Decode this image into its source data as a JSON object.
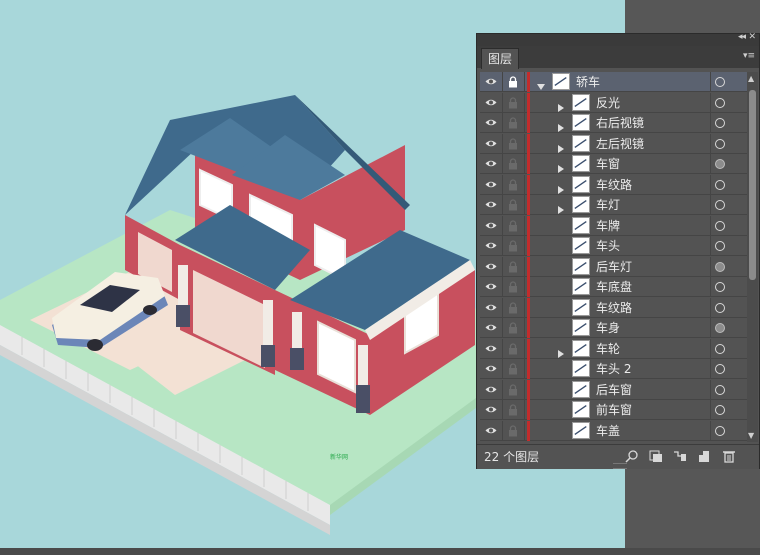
{
  "panel": {
    "tab_label": "图层",
    "collapse_glyph": "◂◂",
    "close_glyph": "✕",
    "menu_glyph": "▾≡",
    "footer_count": "22 个图层",
    "colors": {
      "panel_bg": "#535353",
      "layer_color": "#c22c2c",
      "top_row_bg": "#5b6270"
    }
  },
  "layers": [
    {
      "name": "轿车",
      "level": 0,
      "expanded": true,
      "has_children": true,
      "selected_target": false
    },
    {
      "name": "反光",
      "level": 1,
      "expanded": false,
      "has_children": true,
      "selected_target": false
    },
    {
      "name": "右后视镜",
      "level": 1,
      "expanded": false,
      "has_children": true,
      "selected_target": false
    },
    {
      "name": "左后视镜",
      "level": 1,
      "expanded": false,
      "has_children": true,
      "selected_target": false
    },
    {
      "name": "车窗",
      "level": 1,
      "expanded": false,
      "has_children": true,
      "selected_target": true
    },
    {
      "name": "车纹路",
      "level": 1,
      "expanded": false,
      "has_children": true,
      "selected_target": false
    },
    {
      "name": "车灯",
      "level": 1,
      "expanded": false,
      "has_children": true,
      "selected_target": false
    },
    {
      "name": "车牌",
      "level": 1,
      "expanded": false,
      "has_children": false,
      "selected_target": false
    },
    {
      "name": "车头",
      "level": 1,
      "expanded": false,
      "has_children": false,
      "selected_target": false
    },
    {
      "name": "后车灯",
      "level": 1,
      "expanded": false,
      "has_children": false,
      "selected_target": true
    },
    {
      "name": "车底盘",
      "level": 1,
      "expanded": false,
      "has_children": false,
      "selected_target": false
    },
    {
      "name": "车纹路",
      "level": 1,
      "expanded": false,
      "has_children": false,
      "selected_target": false
    },
    {
      "name": "车身",
      "level": 1,
      "expanded": false,
      "has_children": false,
      "selected_target": true
    },
    {
      "name": "车轮",
      "level": 1,
      "expanded": false,
      "has_children": true,
      "selected_target": false
    },
    {
      "name": "车头 2",
      "level": 1,
      "expanded": false,
      "has_children": false,
      "selected_target": false
    },
    {
      "name": "后车窗",
      "level": 1,
      "expanded": false,
      "has_children": false,
      "selected_target": false
    },
    {
      "name": "前车窗",
      "level": 1,
      "expanded": false,
      "has_children": false,
      "selected_target": false
    },
    {
      "name": "车盖",
      "level": 1,
      "expanded": false,
      "has_children": false,
      "selected_target": false
    }
  ],
  "artwork": {
    "small_label": "新华网",
    "colors": {
      "sky": "#a8d7da",
      "grass": "#b7e6c4",
      "roof": "#3f6a8c",
      "wall": "#c8505e",
      "trim": "#f1ece6",
      "car_body": "#6b86b8"
    }
  }
}
